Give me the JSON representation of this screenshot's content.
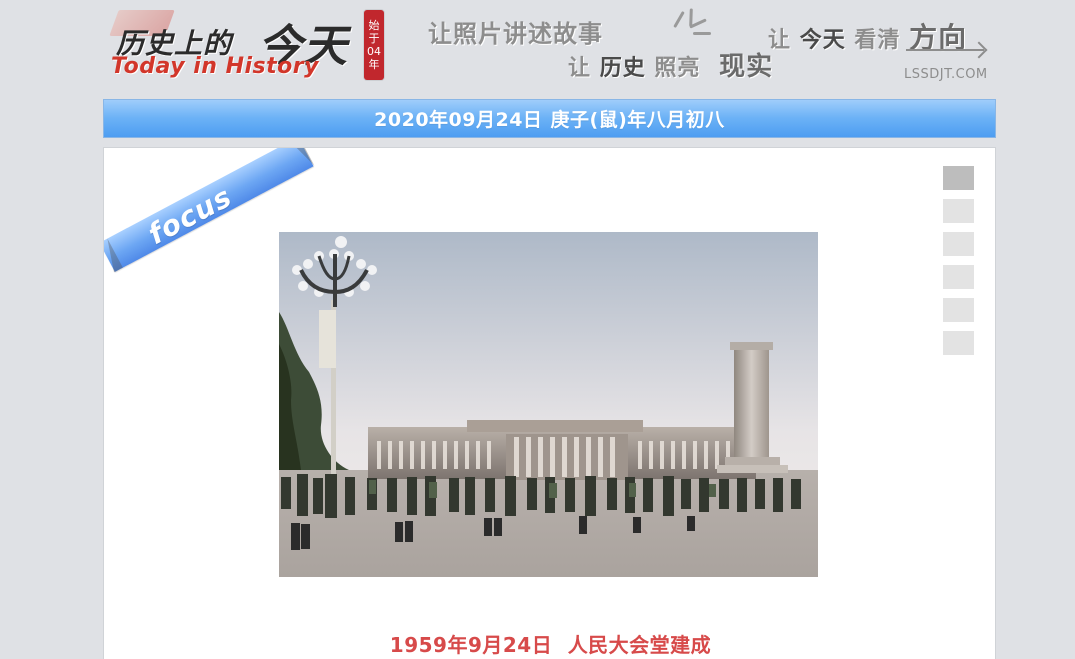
{
  "logo": {
    "cn_prefix": "历史上的",
    "cn_main": "今天",
    "en": "Today in History",
    "seal_chars": [
      "始",
      "于",
      "04",
      "年"
    ]
  },
  "header": {
    "slogan_line_1": "让照片讲述故事",
    "slogan_line_2_a": "让",
    "slogan_line_2_b": "历史",
    "slogan_line_2_c": "照亮",
    "slogan_line_2_d": "现实",
    "slogan_line_3_a": "让",
    "slogan_line_3_b": "今天",
    "slogan_line_3_c": "看清",
    "slogan_line_3_d": "方向",
    "domain": "LSSDJT.COM"
  },
  "datebar": {
    "gregorian": "2020年09月24日",
    "lunar": "庚子(鼠)年八月初八"
  },
  "feature": {
    "ribbon_label": "focus",
    "caption_date": "1959年9月24日",
    "caption_title": "人民大会堂建成",
    "thumbs_count": 6,
    "active_thumb": 1
  }
}
